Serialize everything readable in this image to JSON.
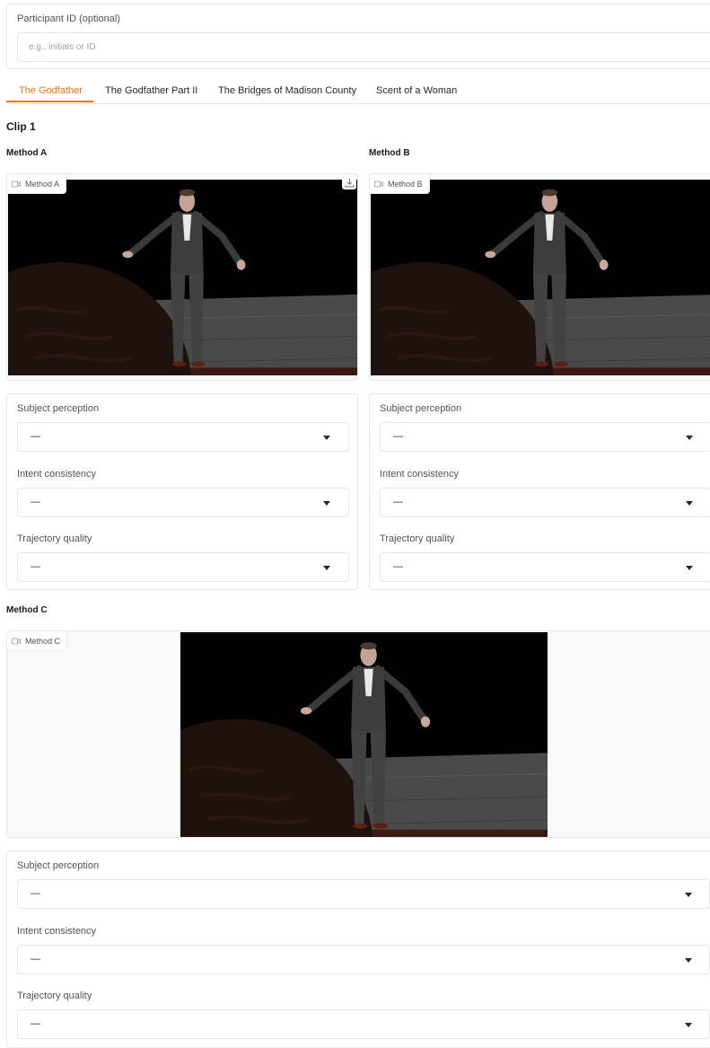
{
  "participant": {
    "label": "Participant ID (optional)",
    "placeholder": "e.g., initials or ID",
    "value": ""
  },
  "tabs": [
    {
      "label": "The Godfather",
      "active": true
    },
    {
      "label": "The Godfather Part II",
      "active": false
    },
    {
      "label": "The Bridges of Madison County",
      "active": false
    },
    {
      "label": "Scent of a Woman",
      "active": false
    }
  ],
  "clip": {
    "title": "Clip 1",
    "methods": [
      {
        "heading": "Method A",
        "video_label": "Method A",
        "fields": [
          {
            "label": "Subject perception",
            "value": "—"
          },
          {
            "label": "Intent consistency",
            "value": "—"
          },
          {
            "label": "Trajectory quality",
            "value": "—"
          }
        ]
      },
      {
        "heading": "Method B",
        "video_label": "Method B",
        "fields": [
          {
            "label": "Subject perception",
            "value": "—"
          },
          {
            "label": "Intent consistency",
            "value": "—"
          },
          {
            "label": "Trajectory quality",
            "value": "—"
          }
        ]
      },
      {
        "heading": "Method C",
        "video_label": "Method C",
        "fields": [
          {
            "label": "Subject perception",
            "value": "—"
          },
          {
            "label": "Intent consistency",
            "value": "—"
          },
          {
            "label": "Trajectory quality",
            "value": "—"
          }
        ]
      }
    ]
  },
  "icons": {
    "video_label": "camera-icon",
    "download": "download-icon",
    "dropdown": "chevron-down-icon"
  },
  "colors": {
    "accent": "#f97316",
    "border": "#e5e7eb",
    "text": "#27272a",
    "muted": "#52525b"
  }
}
